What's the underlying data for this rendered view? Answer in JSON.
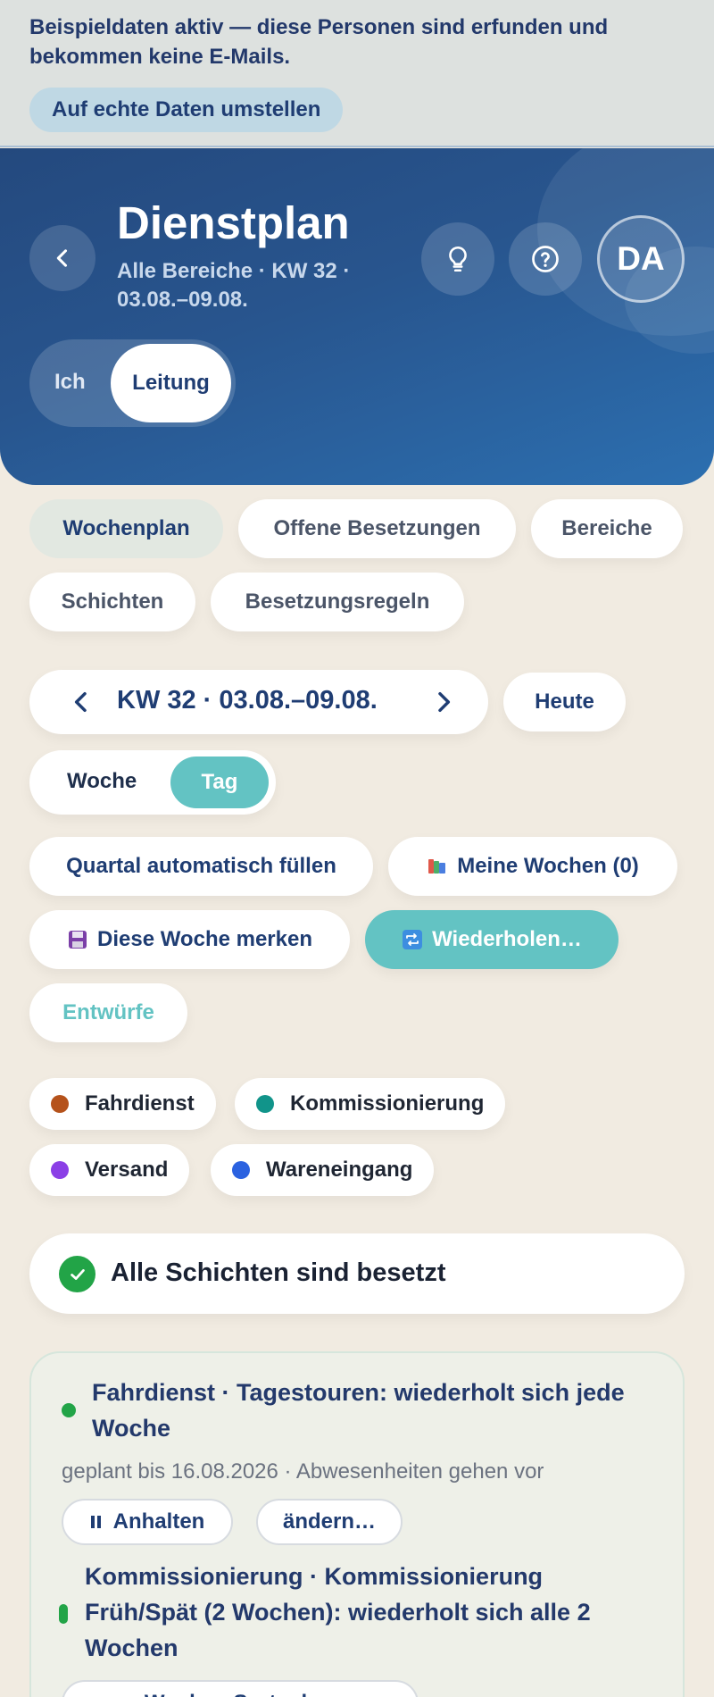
{
  "banner": {
    "text": "Beispieldaten aktiv — diese Personen sind erfunden und bekommen keine E-Mails.",
    "button_label": "Auf echte Daten umstellen"
  },
  "header": {
    "title": "Dienstplan",
    "subtitle": "Alle Bereiche · KW 32 · 03.08.–09.08.",
    "avatar_initials": "DA",
    "role_toggle": {
      "options": [
        "Ich",
        "Leitung"
      ],
      "selected": "Leitung"
    }
  },
  "tabs": [
    {
      "label": "Wochenplan",
      "active": true
    },
    {
      "label": "Offene Besetzungen",
      "active": false
    },
    {
      "label": "Bereiche",
      "active": false
    },
    {
      "label": "Schichten",
      "active": false
    },
    {
      "label": "Besetzungsregeln",
      "active": false
    }
  ],
  "week_nav": {
    "label": "KW 32 · 03.08.–09.08.",
    "today_label": "Heute"
  },
  "view_toggle": {
    "options": [
      "Woche",
      "Tag"
    ],
    "selected": "Tag"
  },
  "actions": {
    "fill_quarter": "Quartal automatisch füllen",
    "my_weeks": "Meine Wochen (0)",
    "save_week": "Diese Woche merken",
    "repeat": "Wiederholen…",
    "drafts": "Entwürfe"
  },
  "legend": [
    {
      "label": "Fahrdienst",
      "color": "#b5521b"
    },
    {
      "label": "Kommissionierung",
      "color": "#11948a"
    },
    {
      "label": "Versand",
      "color": "#8b3fe6"
    },
    {
      "label": "Wareneingang",
      "color": "#2b62e0"
    }
  ],
  "status": {
    "text": "Alle Schichten sind besetzt",
    "color": "#22a447"
  },
  "recurrences": [
    {
      "title": "Fahrdienst · Tagestouren: wiederholt sich jede Woche",
      "meta": "geplant bis 16.08.2026 · Abwesenheiten gehen vor",
      "pause_label": "Anhalten",
      "edit_label": "ändern…"
    },
    {
      "title": "Kommissionierung · Kommissionierung Früh/Spät (2 Wochen): wiederholt sich alle 2 Wochen",
      "button_label": "Woche · Sortenh…"
    }
  ]
}
